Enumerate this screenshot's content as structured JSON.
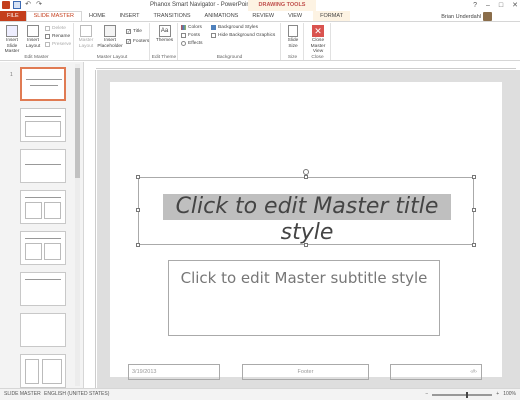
{
  "window": {
    "title": "Phanox Smart Navigator - PowerPoint",
    "context_tab_group": "DRAWING TOOLS",
    "user": "Brian Underdahl",
    "controls": [
      "?",
      "–",
      "□",
      "✕"
    ]
  },
  "tabs": [
    "FILE",
    "SLIDE MASTER",
    "HOME",
    "INSERT",
    "TRANSITIONS",
    "ANIMATIONS",
    "REVIEW",
    "VIEW",
    "FORMAT"
  ],
  "ribbon": {
    "edit_master": {
      "label": "Edit Master",
      "insert_slide_master": "Insert Slide Master",
      "insert_layout": "Insert Layout",
      "delete": "Delete",
      "rename": "Rename",
      "preserve": "Preserve"
    },
    "master_layout": {
      "label": "Master Layout",
      "master_layout": "Master Layout",
      "insert_placeholder": "Insert Placeholder",
      "title": "Title",
      "footers": "Footers"
    },
    "edit_theme": {
      "label": "Edit Theme",
      "themes": "Themes"
    },
    "background": {
      "label": "Background",
      "colors": "Colors",
      "fonts": "Fonts",
      "effects": "Effects",
      "background_styles": "Background Styles",
      "hide_background_graphics": "Hide Background Graphics"
    },
    "size": {
      "label": "Size",
      "slide_size": "Slide Size"
    },
    "close": {
      "label": "Close",
      "close_master_view": "Close Master View"
    }
  },
  "thumbnails": [
    {
      "num": "1",
      "selected": true
    },
    {
      "num": "",
      "selected": false
    },
    {
      "num": "",
      "selected": false
    },
    {
      "num": "",
      "selected": false
    },
    {
      "num": "",
      "selected": false
    },
    {
      "num": "",
      "selected": false
    },
    {
      "num": "",
      "selected": false
    },
    {
      "num": "",
      "selected": false
    }
  ],
  "slide": {
    "title": "Click to edit Master title style",
    "subtitle": "Click to edit Master subtitle style",
    "date": "3/19/2013",
    "footer": "Footer",
    "page_number": "‹#›"
  },
  "status": {
    "view": "SLIDE MASTER",
    "language": "ENGLISH (UNITED STATES)",
    "zoom": "100%"
  },
  "colors": {
    "accent": "#c43e1c",
    "context_tab": "#fdf3e3",
    "selection": "#e07b53"
  }
}
